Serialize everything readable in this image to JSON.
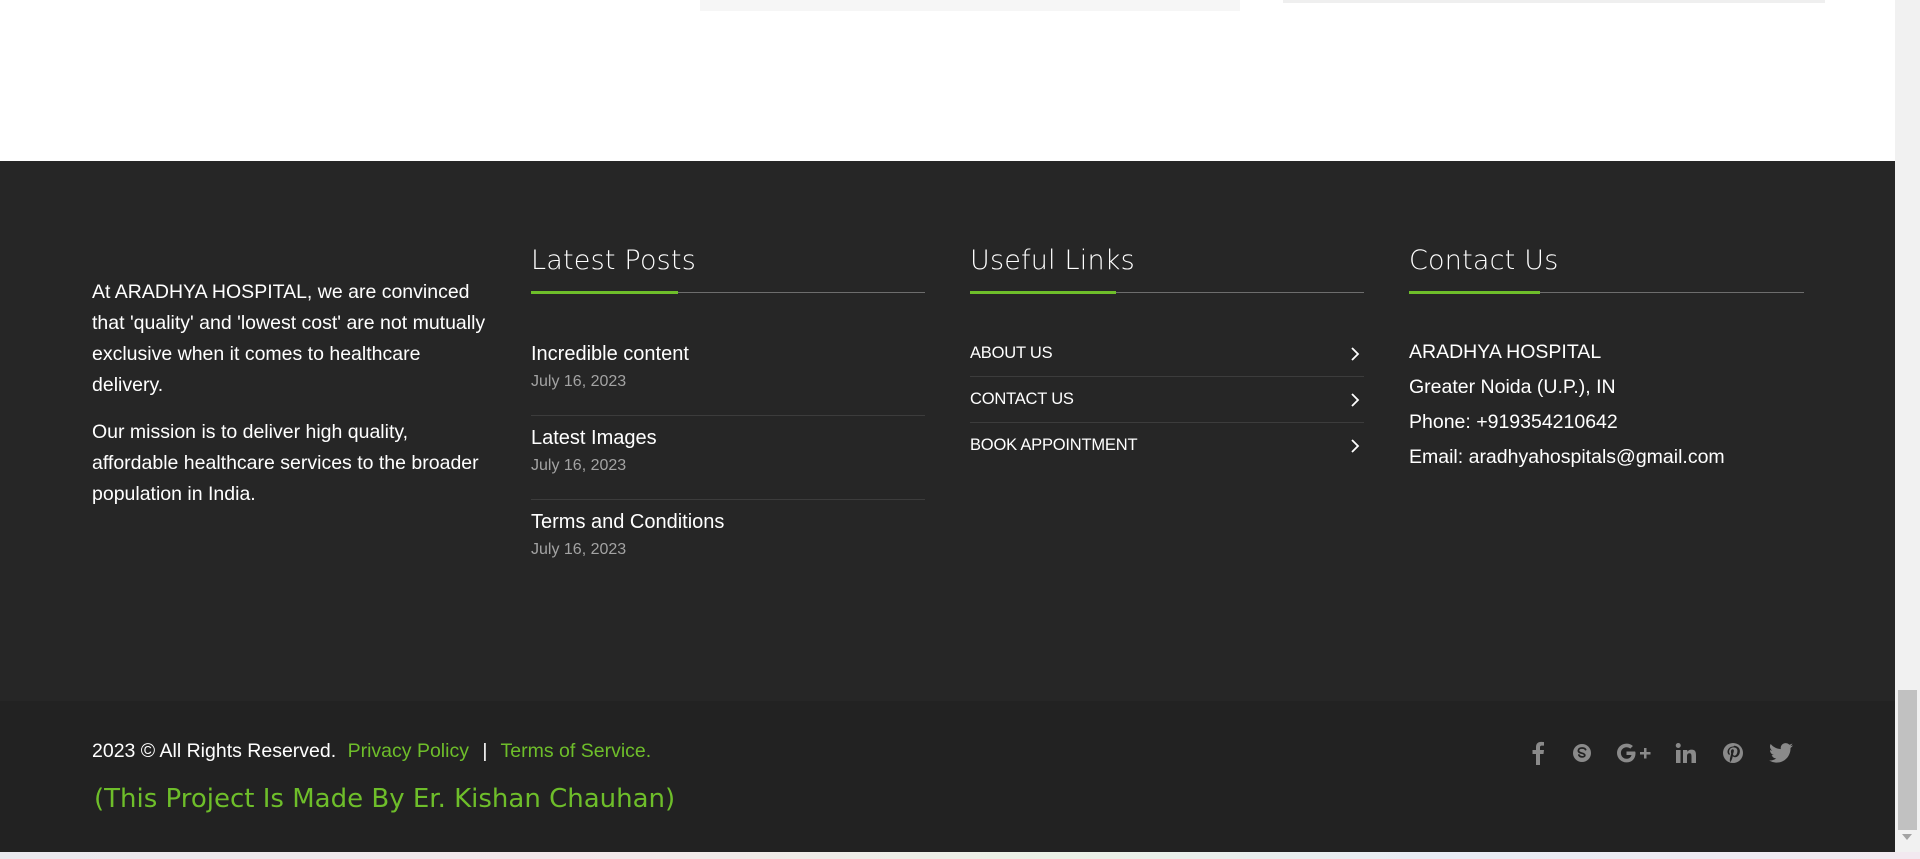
{
  "about": {
    "paragraphs": [
      "At ARADHYA HOSPITAL, we are convinced that 'quality' and 'lowest cost' are not mutually exclusive when it comes to healthcare delivery.",
      "Our mission is to deliver high quality, affordable healthcare services to the broader population in India."
    ]
  },
  "latest_posts": {
    "title": "Latest Posts",
    "items": [
      {
        "title": "Incredible content",
        "date": "July 16, 2023"
      },
      {
        "title": "Latest Images",
        "date": "July 16, 2023"
      },
      {
        "title": "Terms and Conditions",
        "date": "July 16, 2023"
      }
    ]
  },
  "useful_links": {
    "title": "Useful Links",
    "items": [
      {
        "label": "ABOUT US"
      },
      {
        "label": "CONTACT US"
      },
      {
        "label": "BOOK APPOINTMENT"
      }
    ]
  },
  "contact": {
    "title": "Contact Us",
    "name": "ARADHYA HOSPITAL",
    "address": "Greater Noida (U.P.), IN",
    "phone": "Phone: +919354210642",
    "email": "Email: aradhyahospitals@gmail.com"
  },
  "bottom_bar": {
    "copyright": "2023 © All Rights Reserved.",
    "privacy_label": "Privacy Policy",
    "separator": "|",
    "terms_label": "Terms of Service.",
    "made_by": "(This Project Is Made By Er. Kishan Chauhan)",
    "social_icons": [
      "facebook-icon",
      "skype-icon",
      "google-plus-icon",
      "linkedin-icon",
      "pinterest-icon",
      "twitter-icon"
    ]
  },
  "colors": {
    "accent": "#6ebe2a",
    "footer_bg": "#262626",
    "bottom_bg": "#222222",
    "icon": "#8a8a8a"
  }
}
